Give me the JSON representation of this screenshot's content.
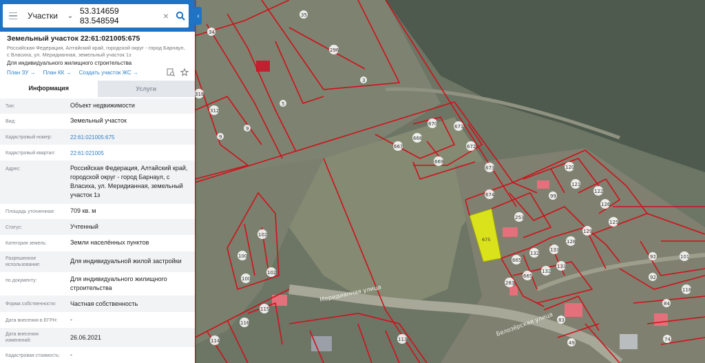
{
  "search": {
    "layer": "Участки",
    "query": "53.314659 83.548594"
  },
  "object": {
    "title": "Земельный участок 22:61:021005:675",
    "address": "Российская Федерация, Алтайский край, городской округ - город Барнаул, с Власиха, ул. Меридианная, земельный участок 1з",
    "purpose": "Для индивидуального жилищного строительства",
    "links": [
      "План ЗУ →",
      "План КК →",
      "Создать участок ЖС →"
    ]
  },
  "tabs": [
    {
      "label": "Информация",
      "active": true
    },
    {
      "label": "Услуги",
      "active": false
    }
  ],
  "info_rows": [
    {
      "key": "Тип:",
      "value": "Объект недвижимости"
    },
    {
      "key": "Вид:",
      "value": "Земельный участок"
    },
    {
      "key": "Кадастровый номер:",
      "value": "22:61:021005:675",
      "link": true
    },
    {
      "key": "Кадастровый квартал:",
      "value": "22:61:021005",
      "link": true
    },
    {
      "key": "Адрес:",
      "value": "Российская Федерация, Алтайский край, городской округ - город Барнаул, с Власиха, ул. Меридианная, земельный участок 1з"
    },
    {
      "key": "Площадь уточненная:",
      "value": "709 кв. м"
    },
    {
      "key": "Статус:",
      "value": "Учтенный"
    },
    {
      "key": "Категория земель:",
      "value": "Земли населённых пунктов"
    },
    {
      "key": "Разрешенное использование:",
      "value": "Для индивидуальной жилой застройки"
    },
    {
      "key": "по документу:",
      "value": "Для индивидуального жилищного строительства"
    },
    {
      "key": "Форма собственности:",
      "value": "Частная собственность"
    },
    {
      "key": "Дата внесения в ЕГРН:",
      "value": "-"
    },
    {
      "key": "Дата внесения изменений:",
      "value": "26.06.2021"
    },
    {
      "key": "Кадастровая стоимость:",
      "value": "-"
    }
  ],
  "map": {
    "streets": [
      "Меридианная улица",
      "Белозёрская улица"
    ],
    "parcel_labels": [
      "35",
      "34",
      "296",
      "3",
      "5",
      "318",
      "312",
      "9",
      "670",
      "671",
      "667",
      "668",
      "672",
      "669",
      "673",
      "674",
      "120",
      "121",
      "122",
      "126",
      "125",
      "99",
      "253",
      "129",
      "128",
      "133",
      "132",
      "665",
      "660",
      "672",
      "283",
      "92",
      "84",
      "83",
      "114",
      "115",
      "116",
      "113",
      "102",
      "100",
      "100",
      "102",
      "675",
      "49",
      "74",
      "28"
    ],
    "highlight_color": "#d9e21a",
    "boundary_color": "#d0101a"
  }
}
